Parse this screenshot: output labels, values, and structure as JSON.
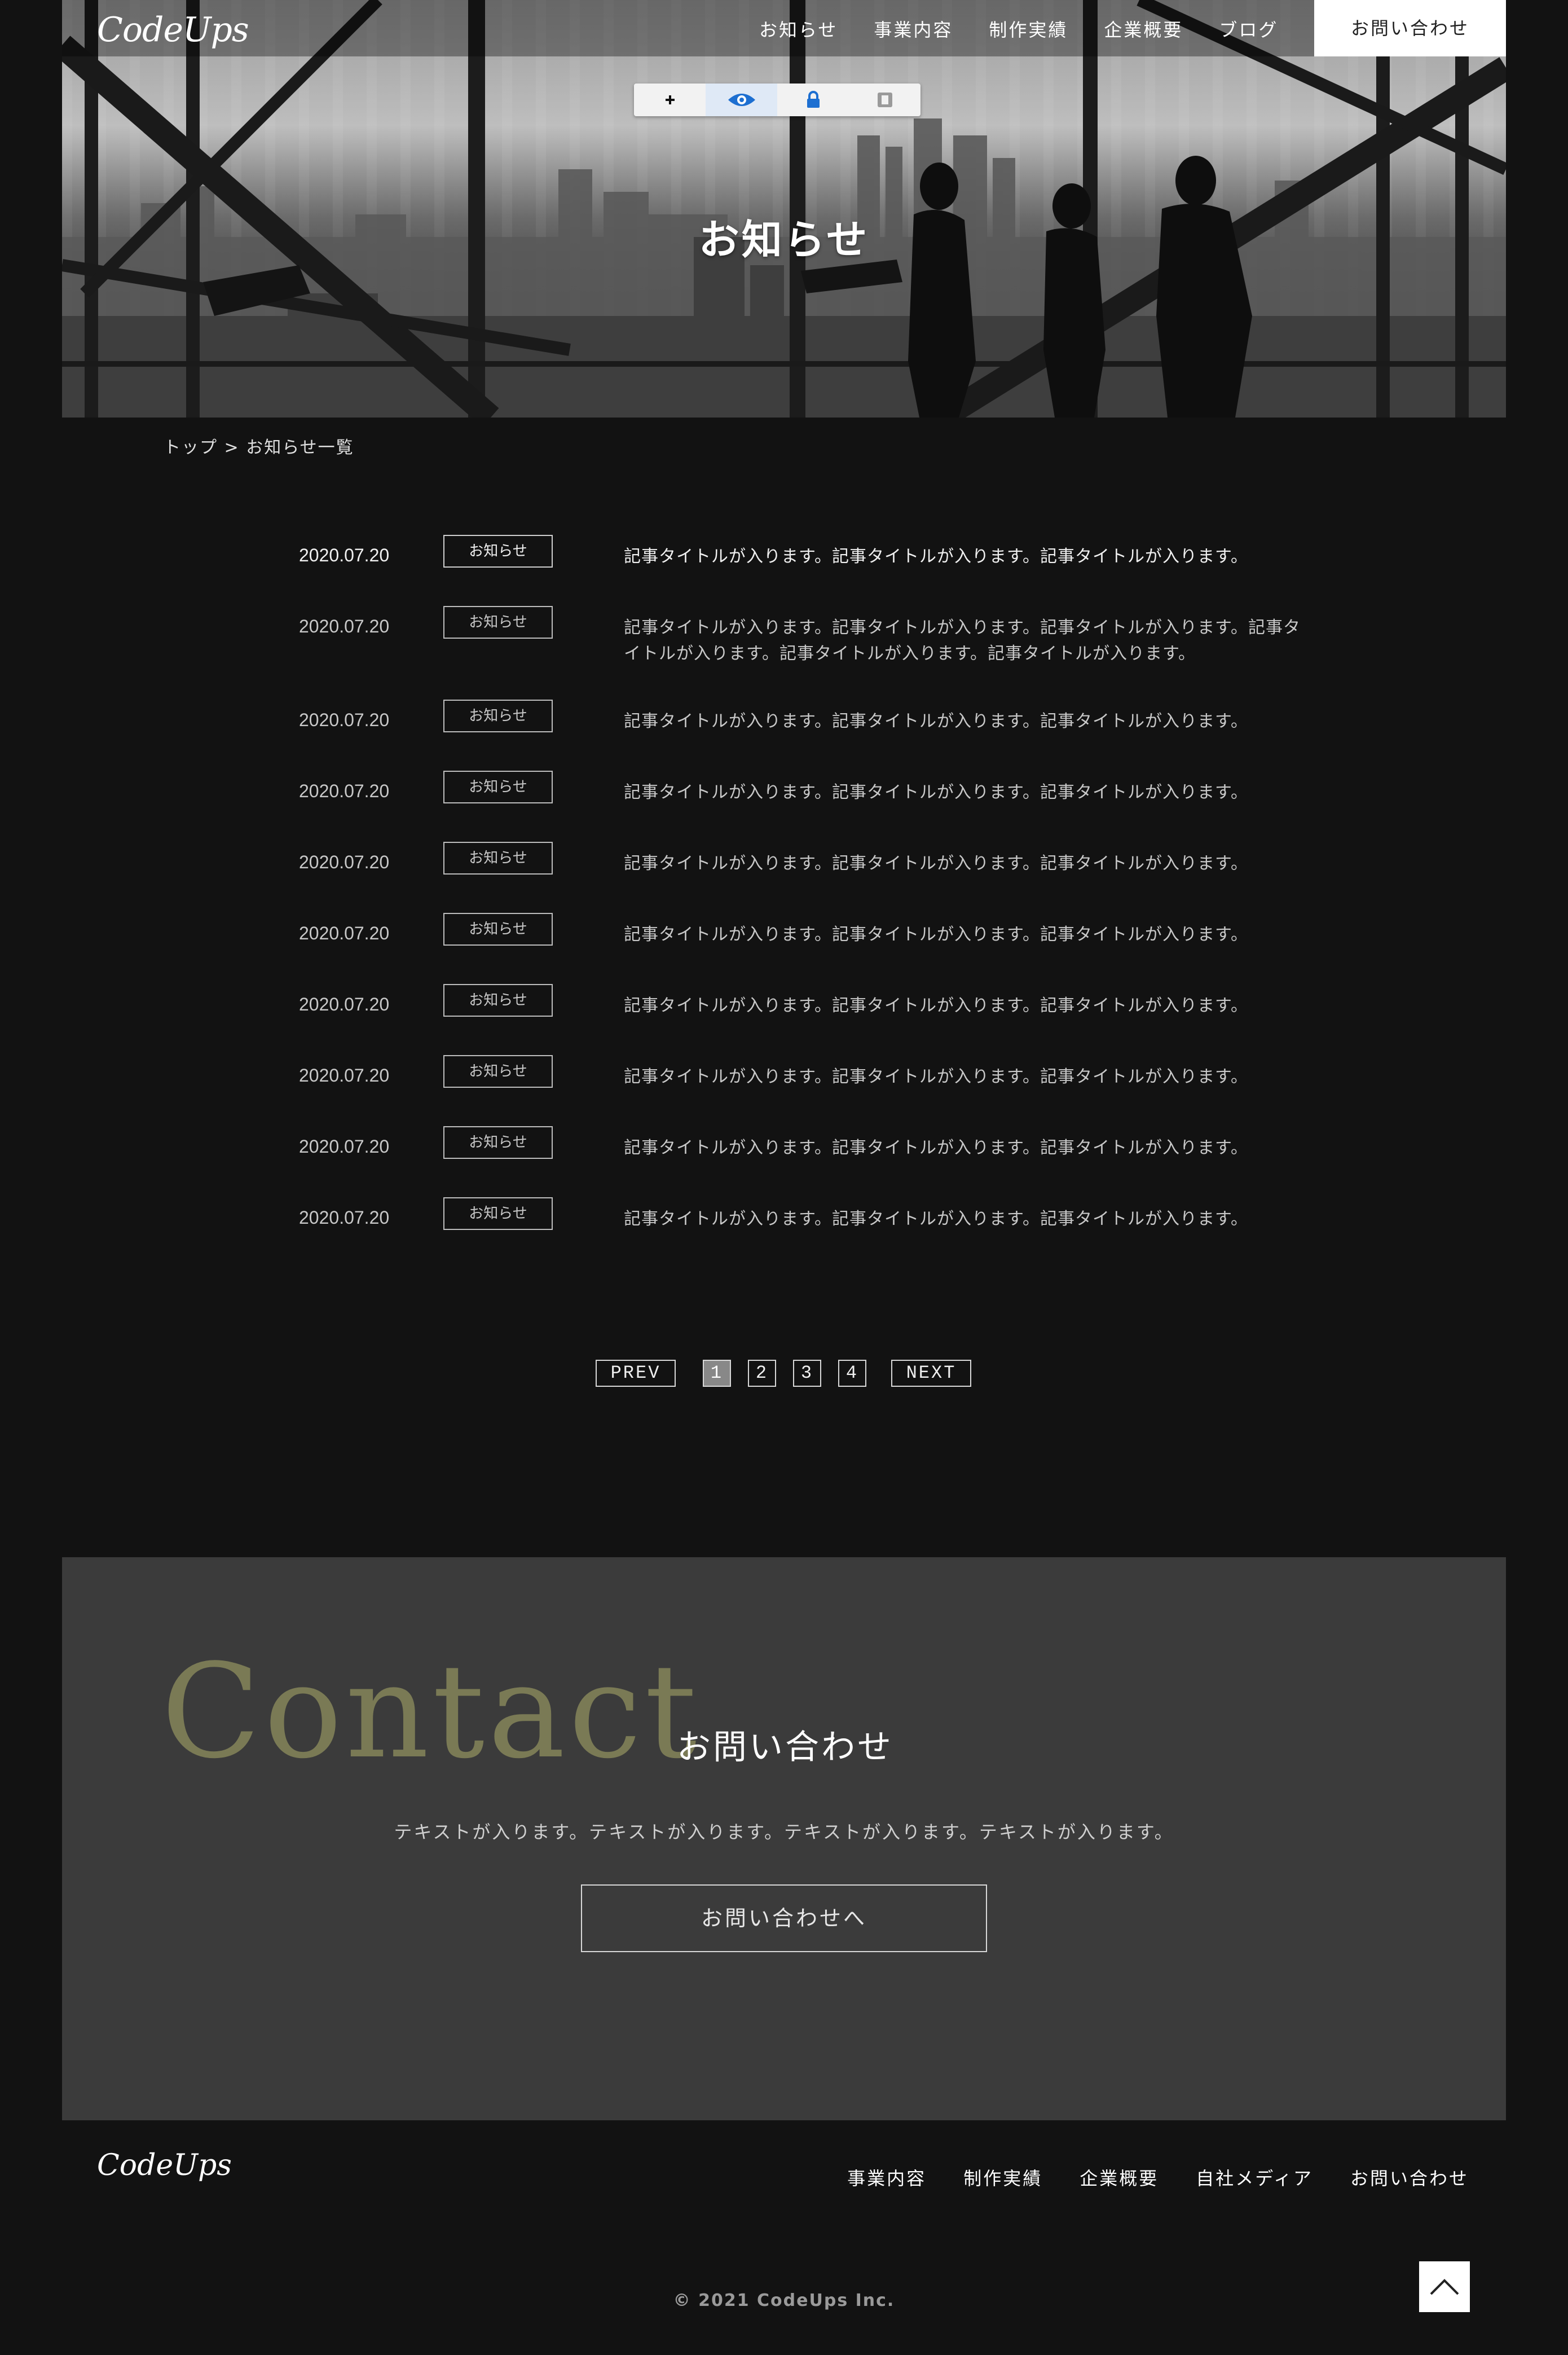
{
  "header": {
    "logo": "CodeUps",
    "nav": [
      "お知らせ",
      "事業内容",
      "制作実績",
      "企業概要",
      "ブログ"
    ],
    "contact_label": "お問い合わせ"
  },
  "toolbar": {
    "icons": [
      "plus-icon",
      "eye-icon",
      "lock-icon",
      "square-icon"
    ],
    "active_index": 1
  },
  "hero": {
    "title": "お知らせ"
  },
  "breadcrumb": {
    "text": "トップ > お知らせ一覧"
  },
  "news": {
    "items": [
      {
        "date": "2020.07.20",
        "category": "お知らせ",
        "title": "記事タイトルが入ります。記事タイトルが入ります。記事タイトルが入ります。"
      },
      {
        "date": "2020.07.20",
        "category": "お知らせ",
        "title": "記事タイトルが入ります。記事タイトルが入ります。記事タイトルが入ります。記事タイトルが入ります。記事タイトルが入ります。記事タイトルが入ります。"
      },
      {
        "date": "2020.07.20",
        "category": "お知らせ",
        "title": "記事タイトルが入ります。記事タイトルが入ります。記事タイトルが入ります。"
      },
      {
        "date": "2020.07.20",
        "category": "お知らせ",
        "title": "記事タイトルが入ります。記事タイトルが入ります。記事タイトルが入ります。"
      },
      {
        "date": "2020.07.20",
        "category": "お知らせ",
        "title": "記事タイトルが入ります。記事タイトルが入ります。記事タイトルが入ります。"
      },
      {
        "date": "2020.07.20",
        "category": "お知らせ",
        "title": "記事タイトルが入ります。記事タイトルが入ります。記事タイトルが入ります。"
      },
      {
        "date": "2020.07.20",
        "category": "お知らせ",
        "title": "記事タイトルが入ります。記事タイトルが入ります。記事タイトルが入ります。"
      },
      {
        "date": "2020.07.20",
        "category": "お知らせ",
        "title": "記事タイトルが入ります。記事タイトルが入ります。記事タイトルが入ります。"
      },
      {
        "date": "2020.07.20",
        "category": "お知らせ",
        "title": "記事タイトルが入ります。記事タイトルが入ります。記事タイトルが入ります。"
      },
      {
        "date": "2020.07.20",
        "category": "お知らせ",
        "title": "記事タイトルが入ります。記事タイトルが入ります。記事タイトルが入ります。"
      }
    ]
  },
  "pagination": {
    "prev": "PREV",
    "pages": [
      "1",
      "2",
      "3",
      "4"
    ],
    "current": "1",
    "next": "NEXT"
  },
  "contact": {
    "heading_en": "Contact",
    "heading_ja": "お問い合わせ",
    "text": "テキストが入ります。テキストが入ります。テキストが入ります。テキストが入ります。",
    "button_label": "お問い合わせへ"
  },
  "footer": {
    "logo": "CodeUps",
    "nav": [
      "事業内容",
      "制作実績",
      "企業概要",
      "自社メディア",
      "お問い合わせ"
    ],
    "copyright": "© 2021 CodeUps Inc."
  },
  "colors": {
    "background": "#121212",
    "contact_bg": "#3b3b3b",
    "contact_accent": "#7a7a55",
    "text": "#f0f0f0"
  }
}
